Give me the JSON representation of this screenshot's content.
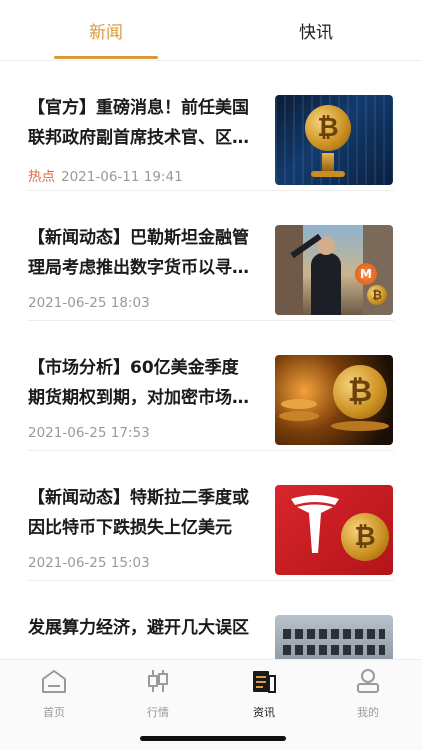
{
  "tabs": {
    "news": "新闻",
    "flash": "快讯"
  },
  "articles": [
    {
      "line1": "【官方】重磅消息！前任美国",
      "line2": "联邦政府副首席技术官、区…",
      "hot": "热点",
      "time": "2021-06-11 19:41"
    },
    {
      "line1": "【新闻动态】巴勒斯坦金融管",
      "line2": "理局考虑推出数字货币以寻…",
      "hot": "",
      "time": "2021-06-25 18:03"
    },
    {
      "line1": "【市场分析】60亿美金季度",
      "line2": "期货期权到期，对加密市场…",
      "hot": "",
      "time": "2021-06-25 17:53"
    },
    {
      "line1": "【新闻动态】特斯拉二季度或",
      "line2": "因比特币下跌损失上亿美元",
      "hot": "",
      "time": "2021-06-25 15:03"
    },
    {
      "line1": "发展算力经济，避开几大误区",
      "line2": "",
      "hot": "",
      "time": ""
    }
  ],
  "thumb_glyphs": {
    "bitcoin": "₿",
    "monero": "M"
  },
  "nav": {
    "home": "首页",
    "market": "行情",
    "info": "资讯",
    "mine": "我的"
  },
  "colors": {
    "accent": "#d99a3c",
    "hot": "#e06a3e"
  }
}
